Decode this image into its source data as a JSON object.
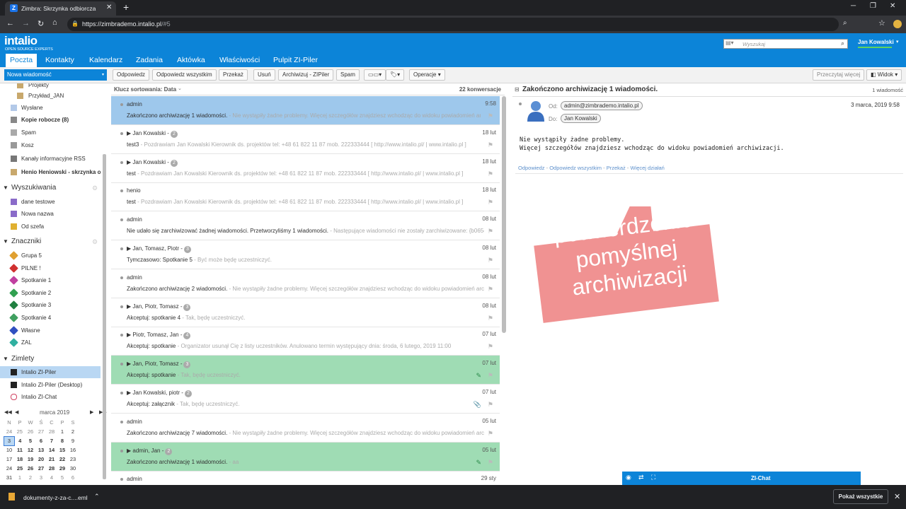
{
  "browser": {
    "tab_title": "Zimbra: Skrzynka odbiorcza",
    "url_host": "https://zimbrademo.intalio.pl",
    "url_path": "/#5"
  },
  "header": {
    "logo": "intalio",
    "logo_sub": "OPEN SOURCE EXPERTS",
    "search_placeholder": "Wyszukaj",
    "user": "Jan Kowalski",
    "tabs": [
      "Poczta",
      "Kontakty",
      "Kalendarz",
      "Zadania",
      "Aktówka",
      "Właściwości",
      "Pulpit ZI-Piler"
    ]
  },
  "toolbar": {
    "new_message": "Nowa wiadomość",
    "buttons": [
      "Odpowiedz",
      "Odpowiedz wszystkim",
      "Przekaż",
      "Usuń",
      "Archiwizuj - ZIPiler",
      "Spam"
    ],
    "operations": "Operacje",
    "read_more": "Przeczytaj więcej",
    "view": "Widok"
  },
  "sidebar": {
    "folders": [
      {
        "label": "Projekty",
        "icon": "folder-icon"
      },
      {
        "label": "Przykład_JAN",
        "icon": "folder-icon"
      },
      {
        "label": "Wysłane",
        "icon": "sent-icon"
      },
      {
        "label": "Kopie robocze (8)",
        "icon": "drafts-icon",
        "bold": true
      },
      {
        "label": "Spam",
        "icon": "spam-icon"
      },
      {
        "label": "Kosz",
        "icon": "trash-icon"
      },
      {
        "label": "Kanały informacyjne RSS",
        "icon": "rss-icon"
      },
      {
        "label": "Henio Heniowski - skrzynka o",
        "icon": "shared-folder-icon",
        "bold": true
      }
    ],
    "searches_header": "Wyszukiwania",
    "searches": [
      "dane testowe",
      "Nowa nazwa",
      "Od szefa"
    ],
    "tags_header": "Znaczniki",
    "tags": [
      {
        "label": "Grupa 5",
        "color": "#e0a030"
      },
      {
        "label": "PILNE !",
        "color": "#d03030"
      },
      {
        "label": "Spotkanie 1",
        "color": "#c040a0"
      },
      {
        "label": "Spotkanie 2",
        "color": "#30a050"
      },
      {
        "label": "Spotkanie 3",
        "color": "#208040"
      },
      {
        "label": "Spotkanie 4",
        "color": "#40a060"
      },
      {
        "label": "Własne",
        "color": "#3050c0"
      },
      {
        "label": "ZAL",
        "color": "#30b0a0"
      }
    ],
    "zimlets_header": "Zimlety",
    "zimlets": [
      "Intalio ZI-Piler",
      "Intalio ZI-Piler (Desktop)",
      "Intalio ZI-Chat"
    ]
  },
  "calendar": {
    "month": "marca 2019",
    "weekdays": [
      "N",
      "P",
      "W",
      "Ś",
      "C",
      "P",
      "S"
    ],
    "weeks": [
      [
        "24",
        "25",
        "26",
        "27",
        "28",
        "1",
        "2"
      ],
      [
        "3",
        "4",
        "5",
        "6",
        "7",
        "8",
        "9"
      ],
      [
        "10",
        "11",
        "12",
        "13",
        "14",
        "15",
        "16"
      ],
      [
        "17",
        "18",
        "19",
        "20",
        "21",
        "22",
        "23"
      ],
      [
        "24",
        "25",
        "26",
        "27",
        "28",
        "29",
        "30"
      ],
      [
        "31",
        "1",
        "2",
        "3",
        "4",
        "5",
        "6"
      ]
    ]
  },
  "list": {
    "sort_label": "Klucz sortowania: Data",
    "count_label": "22 konwersacje",
    "rows": [
      {
        "who": "admin",
        "count": "",
        "date": "9:58",
        "subject": "Zakończono archiwizację 1 wiadomości.",
        "fragment": " - Nie wystąpiły żadne problemy. Więcej szczegółów znajdziesz wchodząc do widoku powiadomień arch",
        "state": "selected",
        "clip": ""
      },
      {
        "who": "▶ Jan Kowalski -",
        "count": "2",
        "date": "18 lut",
        "subject": "test3",
        "fragment": " - Pozdrawiam Jan Kowalski Kierownik ds. projektów tel: +48 61 822 11 87 mob. 222333444 [ http://www.intalio.pl/ | www.intalio.pl ]",
        "state": "",
        "clip": ""
      },
      {
        "who": "▶ Jan Kowalski -",
        "count": "2",
        "date": "18 lut",
        "subject": "test",
        "fragment": " - Pozdrawiam Jan Kowalski Kierownik ds. projektów tel: +48 61 822 11 87 mob. 222333444 [ http://www.intalio.pl/ | www.intalio.pl ]",
        "state": "",
        "clip": ""
      },
      {
        "who": "henio",
        "count": "",
        "date": "18 lut",
        "subject": "test",
        "fragment": " - Pozdrawiam Jan Kowalski Kierownik ds. projektów tel: +48 61 822 11 87 mob. 222333444 [ http://www.intalio.pl/ | www.intalio.pl ]",
        "state": "",
        "clip": ""
      },
      {
        "who": "admin",
        "count": "",
        "date": "08 lut",
        "subject": "Nie udało się zarchiwizować żadnej wiadomości. Przetworzyliśmy 1 wiadomości.",
        "fragment": " - Następujące wiadomości nie zostały zarchiwizowane: {b065e8",
        "state": "",
        "clip": ""
      },
      {
        "who": "▶ Jan, Tomasz, Piotr -",
        "count": "3",
        "date": "08 lut",
        "subject": "Tymczasowo: Spotkanie 5",
        "fragment": " - Być może będę uczestniczyć.",
        "state": "",
        "clip": ""
      },
      {
        "who": "admin",
        "count": "",
        "date": "08 lut",
        "subject": "Zakończono archiwizację 2 wiadomości.",
        "fragment": " - Nie wystąpiły żadne problemy. Więcej szczegółów znajdziesz wchodząc do widoku powiadomień arch",
        "state": "",
        "clip": ""
      },
      {
        "who": "▶ Jan, Piotr, Tomasz -",
        "count": "3",
        "date": "08 lut",
        "subject": "Akceptuj: spotkanie 4",
        "fragment": " - Tak, będę uczestniczyć.",
        "state": "",
        "clip": ""
      },
      {
        "who": "▶ Piotr, Tomasz, Jan -",
        "count": "4",
        "date": "07 lut",
        "subject": "Akceptuj: spotkanie",
        "fragment": " - Organizator usunął Cię z listy uczestników. Anulowano termin występujący dnia: środa, 6 lutego, 2019 11:00",
        "state": "",
        "clip": ""
      },
      {
        "who": "▶ Jan, Piotr, Tomasz -",
        "count": "3",
        "date": "07 lut",
        "subject": "Akceptuj: spotkanie",
        "fragment": " - Tak, będę uczestniczyć.",
        "state": "tagged",
        "clip": "tag"
      },
      {
        "who": "▶ Jan Kowalski, piotr -",
        "count": "2",
        "date": "07 lut",
        "subject": "Akceptuj: załącznik",
        "fragment": " - Tak, będę uczestniczyć.",
        "state": "",
        "clip": "clip"
      },
      {
        "who": "admin",
        "count": "",
        "date": "05 lut",
        "subject": "Zakończono archiwizację 7 wiadomości.",
        "fragment": " - Nie wystąpiły żadne problemy. Więcej szczegółów znajdziesz wchodząc do widoku powiadomień arch",
        "state": "",
        "clip": ""
      },
      {
        "who": "▶ admin, Jan -",
        "count": "2",
        "date": "05 lut",
        "subject": "Zakończono archiwizację 1 wiadomości.",
        "fragment": " - aa",
        "state": "tagged",
        "clip": "tag"
      },
      {
        "who": "admin",
        "count": "",
        "date": "29 sty",
        "subject": "",
        "fragment": "",
        "state": "",
        "clip": ""
      }
    ]
  },
  "reading": {
    "subject": "Zakończono archiwizację 1 wiadomości.",
    "msg_count": "1 wiadomość",
    "from_label": "Od:",
    "from": "admin@zimbrademo.intalio.pl",
    "to_label": "Do:",
    "to": "Jan Kowalski",
    "date": "3 marca, 2019 9:58",
    "body_line1": "Nie wystąpiły żadne problemy.",
    "body_line2": "Więcej szczegółów znajdziesz wchodząc do widoku powiadomień archiwizacji.",
    "actions": [
      "Odpowiedz",
      "Odpowiedz wszystkim",
      "Przekaż",
      "Więcej działań"
    ]
  },
  "callout": {
    "line1": "potwierdzenie",
    "line2": "pomyślnej",
    "line3": "archiwizacji"
  },
  "zichat": "ZI-Chat",
  "downloads": {
    "file": "dokumenty-z-za-c....eml",
    "show_all": "Pokaż wszystkie"
  }
}
